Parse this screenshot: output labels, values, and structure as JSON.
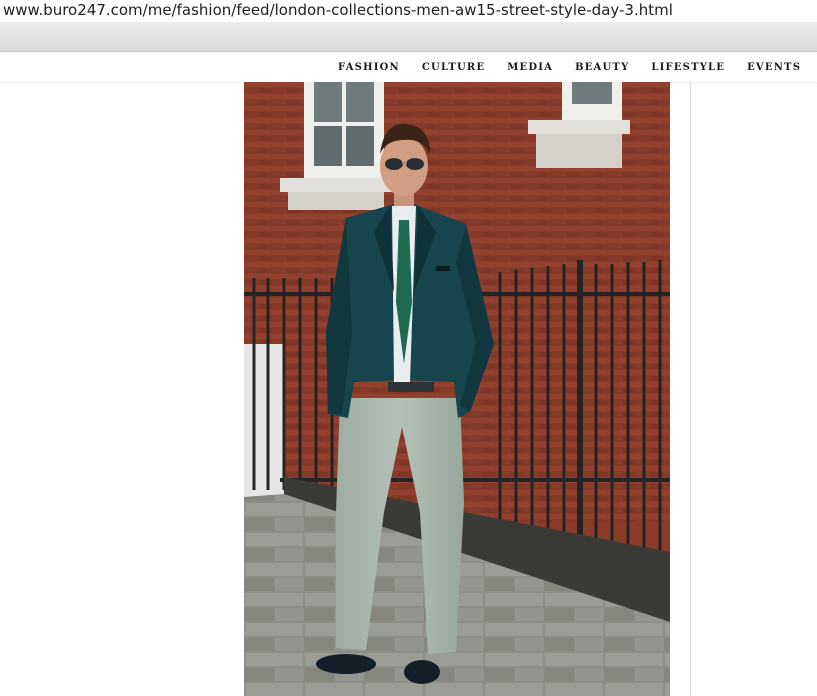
{
  "browser": {
    "url": "www.buro247.com/me/fashion/feed/london-collections-men-aw15-street-style-day-3.html"
  },
  "nav": {
    "items": [
      {
        "label": "FASHION"
      },
      {
        "label": "CULTURE"
      },
      {
        "label": "MEDIA"
      },
      {
        "label": "BEAUTY"
      },
      {
        "label": "LIFESTYLE"
      },
      {
        "label": "EVENTS"
      }
    ]
  },
  "colors": {
    "brick": "#8a3c2b",
    "jacket": "#16454d",
    "trousers": "#a9b7ad",
    "tie": "#1f6b52",
    "pavement": "#8f918c"
  }
}
